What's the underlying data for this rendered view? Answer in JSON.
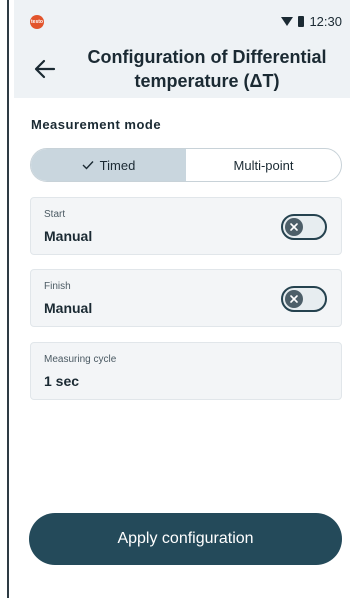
{
  "status_bar": {
    "brand": "testo",
    "time": "12:30"
  },
  "header": {
    "title_line1": "Configuration of Differential",
    "title_line2": "temperature (ΔT)"
  },
  "measurement_mode": {
    "label": "Measurement mode",
    "options": [
      {
        "label": "Timed",
        "selected": true
      },
      {
        "label": "Multi-point",
        "selected": false
      }
    ]
  },
  "settings": [
    {
      "label": "Start",
      "value": "Manual",
      "toggle_on": false
    },
    {
      "label": "Finish",
      "value": "Manual",
      "toggle_on": false
    },
    {
      "label": "Measuring cycle",
      "value": "1 sec"
    }
  ],
  "apply_button": {
    "label": "Apply configuration"
  },
  "colors": {
    "accent": "#244a5a",
    "segment_active": "#c9d6de",
    "brand": "#e2542c"
  }
}
